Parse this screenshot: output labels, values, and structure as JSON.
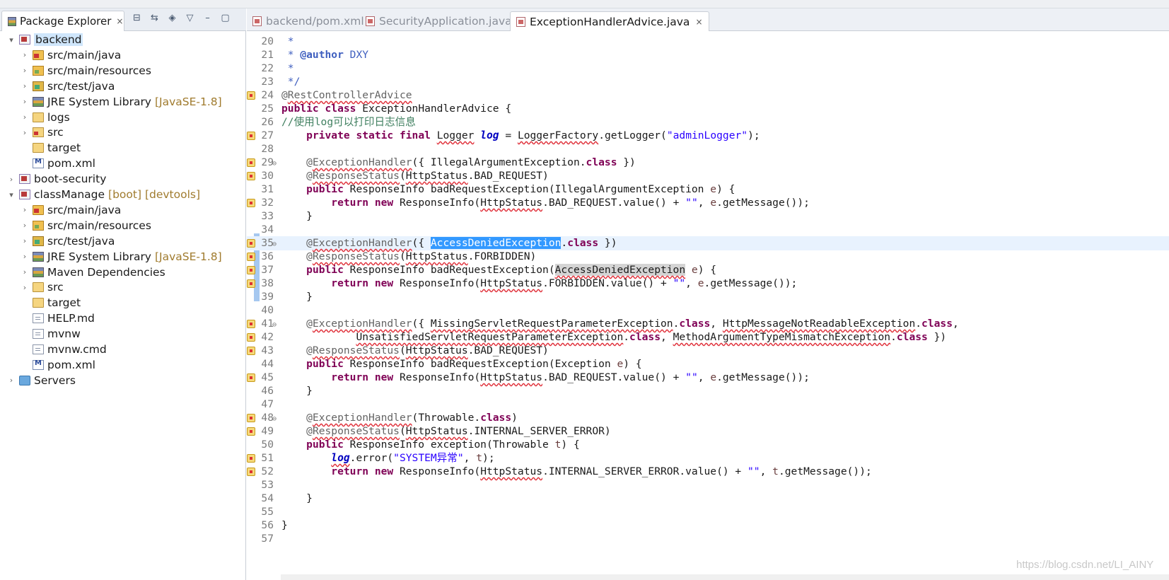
{
  "package_explorer": {
    "tab_label": "Package Explorer",
    "close": "×",
    "tree": [
      {
        "label": "backend",
        "deco": "",
        "icon": "project",
        "arrow": "▾",
        "level": 0,
        "selected": true
      },
      {
        "label": "src/main/java",
        "deco": "",
        "icon": "srcfolder",
        "arrow": "›",
        "level": 1
      },
      {
        "label": "src/main/resources",
        "deco": "",
        "icon": "resfolder",
        "arrow": "›",
        "level": 1
      },
      {
        "label": "src/test/java",
        "deco": "",
        "icon": "testfolder",
        "arrow": "›",
        "level": 1
      },
      {
        "label": "JRE System Library",
        "deco": "[JavaSE-1.8]",
        "icon": "library",
        "arrow": "›",
        "level": 1
      },
      {
        "label": "logs",
        "deco": "",
        "icon": "folder",
        "arrow": "›",
        "level": 1
      },
      {
        "label": "src",
        "deco": "",
        "icon": "folder-red",
        "arrow": "›",
        "level": 1
      },
      {
        "label": "target",
        "deco": "",
        "icon": "folder",
        "arrow": "",
        "level": 1
      },
      {
        "label": "pom.xml",
        "deco": "",
        "icon": "xml",
        "arrow": "",
        "level": 1
      },
      {
        "label": "boot-security",
        "deco": "",
        "icon": "project",
        "arrow": "›",
        "level": 0
      },
      {
        "label": "classManage",
        "deco": "[boot] [devtools]",
        "icon": "project",
        "arrow": "▾",
        "level": 0
      },
      {
        "label": "src/main/java",
        "deco": "",
        "icon": "srcfolder",
        "arrow": "›",
        "level": 1
      },
      {
        "label": "src/main/resources",
        "deco": "",
        "icon": "resfolder",
        "arrow": "›",
        "level": 1
      },
      {
        "label": "src/test/java",
        "deco": "",
        "icon": "testfolder",
        "arrow": "›",
        "level": 1
      },
      {
        "label": "JRE System Library",
        "deco": "[JavaSE-1.8]",
        "icon": "library",
        "arrow": "›",
        "level": 1
      },
      {
        "label": "Maven Dependencies",
        "deco": "",
        "icon": "library",
        "arrow": "›",
        "level": 1
      },
      {
        "label": "src",
        "deco": "",
        "icon": "folder",
        "arrow": "›",
        "level": 1
      },
      {
        "label": "target",
        "deco": "",
        "icon": "folder",
        "arrow": "",
        "level": 1
      },
      {
        "label": "HELP.md",
        "deco": "",
        "icon": "file",
        "arrow": "",
        "level": 1
      },
      {
        "label": "mvnw",
        "deco": "",
        "icon": "file",
        "arrow": "",
        "level": 1
      },
      {
        "label": "mvnw.cmd",
        "deco": "",
        "icon": "file",
        "arrow": "",
        "level": 1
      },
      {
        "label": "pom.xml",
        "deco": "",
        "icon": "xml",
        "arrow": "",
        "level": 1
      },
      {
        "label": "Servers",
        "deco": "",
        "icon": "servers",
        "arrow": "›",
        "level": 0
      }
    ]
  },
  "editor": {
    "tabs": [
      {
        "label": "backend/pom.xml",
        "active": false
      },
      {
        "label": "SecurityApplication.java",
        "active": false
      },
      {
        "label": "ExceptionHandlerAdvice.java",
        "active": true
      }
    ],
    "current_line": 35,
    "lines": [
      {
        "n": "20",
        "m": "",
        "f": "",
        "s": [
          [
            " *",
            "cm"
          ]
        ]
      },
      {
        "n": "21",
        "m": "",
        "f": "",
        "s": [
          [
            " * ",
            "cm"
          ],
          [
            "@author",
            "cm b"
          ],
          [
            " DXY",
            "cm"
          ]
        ]
      },
      {
        "n": "22",
        "m": "",
        "f": "",
        "s": [
          [
            " *",
            "cm"
          ]
        ]
      },
      {
        "n": "23",
        "m": "",
        "f": "",
        "s": [
          [
            " */",
            "cm"
          ]
        ]
      },
      {
        "n": "24",
        "m": "warn",
        "f": "",
        "s": [
          [
            "@",
            "ann"
          ],
          [
            "RestControllerAdvice",
            "ann sq"
          ]
        ]
      },
      {
        "n": "25",
        "m": "",
        "f": "",
        "s": [
          [
            "public",
            "kw"
          ],
          [
            " ",
            ""
          ],
          [
            "class",
            "kw"
          ],
          [
            " ExceptionHandlerAdvice {",
            ""
          ]
        ]
      },
      {
        "n": "26",
        "m": "",
        "f": "",
        "s": [
          [
            "//使用log可以打印日志信息",
            "cmline"
          ]
        ]
      },
      {
        "n": "27",
        "m": "warn",
        "f": "",
        "s": [
          [
            "    ",
            ""
          ],
          [
            "private",
            "kw"
          ],
          [
            " ",
            ""
          ],
          [
            "static",
            "kw"
          ],
          [
            " ",
            ""
          ],
          [
            "final",
            "kw"
          ],
          [
            " ",
            ""
          ],
          [
            "Logger",
            "sq"
          ],
          [
            " ",
            ""
          ],
          [
            "log",
            "field"
          ],
          [
            " = ",
            ""
          ],
          [
            "LoggerFactory",
            "sq"
          ],
          [
            ".getLogger(",
            ""
          ],
          [
            "\"adminLogger\"",
            "str"
          ],
          [
            ");",
            ""
          ]
        ]
      },
      {
        "n": "28",
        "m": "",
        "f": "",
        "s": []
      },
      {
        "n": "29",
        "m": "warn",
        "f": "⊖",
        "s": [
          [
            "    @",
            "ann"
          ],
          [
            "ExceptionHandler",
            "ann sq"
          ],
          [
            "({ IllegalArgumentException.",
            ""
          ],
          [
            "class",
            "kw"
          ],
          [
            " })",
            ""
          ]
        ]
      },
      {
        "n": "30",
        "m": "warn",
        "f": "",
        "s": [
          [
            "    @",
            "ann"
          ],
          [
            "ResponseStatus",
            "ann sq"
          ],
          [
            "(",
            ""
          ],
          [
            "HttpStatus",
            "sq"
          ],
          [
            ".BAD_REQUEST)",
            ""
          ]
        ]
      },
      {
        "n": "31",
        "m": "",
        "f": "",
        "s": [
          [
            "    ",
            ""
          ],
          [
            "public",
            "kw"
          ],
          [
            " ResponseInfo badRequestException(IllegalArgumentException ",
            ""
          ],
          [
            "e",
            "param"
          ],
          [
            ") {",
            ""
          ]
        ]
      },
      {
        "n": "32",
        "m": "warn",
        "f": "",
        "s": [
          [
            "        ",
            ""
          ],
          [
            "return",
            "kw"
          ],
          [
            " ",
            ""
          ],
          [
            "new",
            "kw"
          ],
          [
            " ResponseInfo(",
            ""
          ],
          [
            "HttpStatus",
            "sq"
          ],
          [
            ".BAD_REQUEST.value() + ",
            ""
          ],
          [
            "\"\"",
            "str"
          ],
          [
            ", ",
            ""
          ],
          [
            "e",
            "param"
          ],
          [
            ".getMessage());",
            ""
          ]
        ]
      },
      {
        "n": "33",
        "m": "",
        "f": "",
        "s": [
          [
            "    }",
            ""
          ]
        ]
      },
      {
        "n": "34",
        "m": "",
        "f": "",
        "s": []
      },
      {
        "n": "35",
        "m": "warn",
        "f": "⊖",
        "s": [
          [
            "    @",
            "ann"
          ],
          [
            "ExceptionHandler",
            "ann sq"
          ],
          [
            "({ ",
            ""
          ],
          [
            "AccessDeniedException",
            "sel"
          ],
          [
            ".",
            ""
          ],
          [
            "class",
            "kw"
          ],
          [
            " })",
            ""
          ]
        ]
      },
      {
        "n": "36",
        "m": "warn",
        "f": "",
        "s": [
          [
            "    @",
            "ann"
          ],
          [
            "ResponseStatus",
            "ann sq"
          ],
          [
            "(",
            ""
          ],
          [
            "HttpStatus",
            "sq"
          ],
          [
            ".FORBIDDEN)",
            ""
          ]
        ]
      },
      {
        "n": "37",
        "m": "warn",
        "f": "",
        "s": [
          [
            "    ",
            ""
          ],
          [
            "public",
            "kw"
          ],
          [
            " ResponseInfo badRequestException(",
            ""
          ],
          [
            "AccessDeniedException",
            "occ sq"
          ],
          [
            " ",
            ""
          ],
          [
            "e",
            "param"
          ],
          [
            ") {",
            ""
          ]
        ]
      },
      {
        "n": "38",
        "m": "warn",
        "f": "",
        "s": [
          [
            "        ",
            ""
          ],
          [
            "return",
            "kw"
          ],
          [
            " ",
            ""
          ],
          [
            "new",
            "kw"
          ],
          [
            " ResponseInfo(",
            ""
          ],
          [
            "HttpStatus",
            "sq"
          ],
          [
            ".FORBIDDEN.value() + ",
            ""
          ],
          [
            "\"\"",
            "str"
          ],
          [
            ", ",
            ""
          ],
          [
            "e",
            "param"
          ],
          [
            ".getMessage());",
            ""
          ]
        ]
      },
      {
        "n": "39",
        "m": "",
        "f": "",
        "s": [
          [
            "    }",
            ""
          ]
        ]
      },
      {
        "n": "40",
        "m": "",
        "f": "",
        "s": []
      },
      {
        "n": "41",
        "m": "warn",
        "f": "⊖",
        "s": [
          [
            "    @",
            "ann"
          ],
          [
            "ExceptionHandler",
            "ann sq"
          ],
          [
            "({ ",
            ""
          ],
          [
            "MissingServletRequestParameterException",
            "sq"
          ],
          [
            ".",
            ""
          ],
          [
            "class",
            "kw"
          ],
          [
            ", ",
            ""
          ],
          [
            "HttpMessageNotReadableException",
            "sq"
          ],
          [
            ".",
            ""
          ],
          [
            "class",
            "kw"
          ],
          [
            ",",
            ""
          ]
        ]
      },
      {
        "n": "42",
        "m": "warn",
        "f": "",
        "s": [
          [
            "            ",
            ""
          ],
          [
            "UnsatisfiedServletRequestParameterException",
            "sq"
          ],
          [
            ".",
            ""
          ],
          [
            "class",
            "kw"
          ],
          [
            ", ",
            ""
          ],
          [
            "MethodArgumentTypeMismatchException",
            "sq"
          ],
          [
            ".",
            ""
          ],
          [
            "class",
            "kw"
          ],
          [
            " })",
            ""
          ]
        ]
      },
      {
        "n": "43",
        "m": "warn",
        "f": "",
        "s": [
          [
            "    @",
            "ann"
          ],
          [
            "ResponseStatus",
            "ann sq"
          ],
          [
            "(",
            ""
          ],
          [
            "HttpStatus",
            "sq"
          ],
          [
            ".BAD_REQUEST)",
            ""
          ]
        ]
      },
      {
        "n": "44",
        "m": "",
        "f": "",
        "s": [
          [
            "    ",
            ""
          ],
          [
            "public",
            "kw"
          ],
          [
            " ResponseInfo badRequestException(Exception ",
            ""
          ],
          [
            "e",
            "param"
          ],
          [
            ") {",
            ""
          ]
        ]
      },
      {
        "n": "45",
        "m": "warn",
        "f": "",
        "s": [
          [
            "        ",
            ""
          ],
          [
            "return",
            "kw"
          ],
          [
            " ",
            ""
          ],
          [
            "new",
            "kw"
          ],
          [
            " ResponseInfo(",
            ""
          ],
          [
            "HttpStatus",
            "sq"
          ],
          [
            ".BAD_REQUEST.value() + ",
            ""
          ],
          [
            "\"\"",
            "str"
          ],
          [
            ", ",
            ""
          ],
          [
            "e",
            "param"
          ],
          [
            ".getMessage());",
            ""
          ]
        ]
      },
      {
        "n": "46",
        "m": "",
        "f": "",
        "s": [
          [
            "    }",
            ""
          ]
        ]
      },
      {
        "n": "47",
        "m": "",
        "f": "",
        "s": []
      },
      {
        "n": "48",
        "m": "warn",
        "f": "⊖",
        "s": [
          [
            "    @",
            "ann"
          ],
          [
            "ExceptionHandler",
            "ann sq"
          ],
          [
            "(Throwable.",
            ""
          ],
          [
            "class",
            "kw"
          ],
          [
            ")",
            ""
          ]
        ]
      },
      {
        "n": "49",
        "m": "warn",
        "f": "",
        "s": [
          [
            "    @",
            "ann"
          ],
          [
            "ResponseStatus",
            "ann sq"
          ],
          [
            "(",
            ""
          ],
          [
            "HttpStatus",
            "sq"
          ],
          [
            ".INTERNAL_SERVER_ERROR)",
            ""
          ]
        ]
      },
      {
        "n": "50",
        "m": "",
        "f": "",
        "s": [
          [
            "    ",
            ""
          ],
          [
            "public",
            "kw"
          ],
          [
            " ResponseInfo exception(Throwable ",
            ""
          ],
          [
            "t",
            "param"
          ],
          [
            ") {",
            ""
          ]
        ]
      },
      {
        "n": "51",
        "m": "warn",
        "f": "",
        "s": [
          [
            "        ",
            ""
          ],
          [
            "log",
            "field sq"
          ],
          [
            ".error(",
            ""
          ],
          [
            "\"SYSTEM异常\"",
            "str"
          ],
          [
            ", ",
            ""
          ],
          [
            "t",
            "param"
          ],
          [
            ");",
            ""
          ]
        ]
      },
      {
        "n": "52",
        "m": "warn",
        "f": "",
        "s": [
          [
            "        ",
            ""
          ],
          [
            "return",
            "kw"
          ],
          [
            " ",
            ""
          ],
          [
            "new",
            "kw"
          ],
          [
            " ResponseInfo(",
            ""
          ],
          [
            "HttpStatus",
            "sq"
          ],
          [
            ".INTERNAL_SERVER_ERROR.value() + ",
            ""
          ],
          [
            "\"\"",
            "str"
          ],
          [
            ", ",
            ""
          ],
          [
            "t",
            "param"
          ],
          [
            ".getMessage());",
            ""
          ]
        ]
      },
      {
        "n": "53",
        "m": "",
        "f": "",
        "s": []
      },
      {
        "n": "54",
        "m": "",
        "f": "",
        "s": [
          [
            "    }",
            ""
          ]
        ]
      },
      {
        "n": "55",
        "m": "",
        "f": "",
        "s": []
      },
      {
        "n": "56",
        "m": "",
        "f": "",
        "s": [
          [
            "}",
            ""
          ]
        ]
      },
      {
        "n": "57",
        "m": "",
        "f": "",
        "s": []
      }
    ]
  },
  "watermark": "https://blog.csdn.net/LI_AINY",
  "colors": {
    "keyword": "#7f0055",
    "string": "#2a00ff",
    "javadoc": "#3f5fbf",
    "line_comment": "#3f7f5f",
    "selection": "#3399ff",
    "current_line": "#e8f2fe",
    "tree_selection": "#cfe6fb"
  }
}
